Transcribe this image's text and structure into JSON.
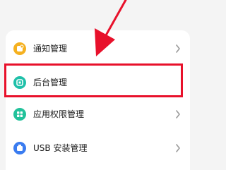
{
  "settings_list": {
    "items": [
      {
        "label": "通知管理",
        "icon": "notification-icon",
        "icon_color": "#f5b120"
      },
      {
        "label": "后台管理",
        "icon": "background-icon",
        "icon_color": "#1fc0a9"
      },
      {
        "label": "应用权限管理",
        "icon": "permission-icon",
        "icon_color": "#22c29b"
      },
      {
        "label": "USB 安装管理",
        "icon": "usb-icon",
        "icon_color": "#3a7cf0"
      }
    ]
  },
  "annotation": {
    "highlight_color": "#e8112b",
    "arrow_color": "#e8112b"
  }
}
